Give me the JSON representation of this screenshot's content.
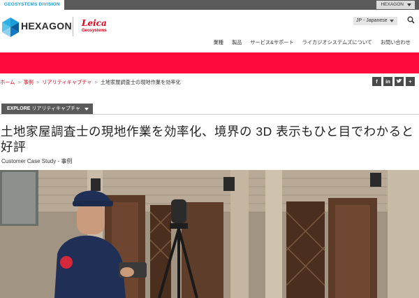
{
  "topbar": {
    "division": "GEOSYSTEMS DIVISION",
    "hexagon_menu": "HEXAGON"
  },
  "header": {
    "logo_text": "HEXAGON",
    "partner_name": "Leica",
    "partner_sub": "Geosystems",
    "language": "JP - Japanese",
    "nav": [
      "業種",
      "製品",
      "サービス&サポート",
      "ライカジオシステムズについて",
      "お問い合わせ"
    ]
  },
  "breadcrumb": {
    "items": [
      "ホーム",
      "事例",
      "リアリティキャプチャ"
    ],
    "current": "土地家屋調査士の現地作業を効率化"
  },
  "social": [
    "f",
    "in",
    "♥",
    "+"
  ],
  "explore": {
    "prefix": "EXPLORE",
    "label": "リアリティキャプチャ"
  },
  "article": {
    "title": "土地家屋調査士の現地作業を効率化、境界の 3D 表示もひと目でわかると好評",
    "subtitle": "Customer Case Study - 事例"
  },
  "colors": {
    "brand_red": "#ff0a3a",
    "link_red": "#e2001a",
    "division_blue": "#1a9ed8",
    "dark_grey": "#5a5a5a"
  }
}
